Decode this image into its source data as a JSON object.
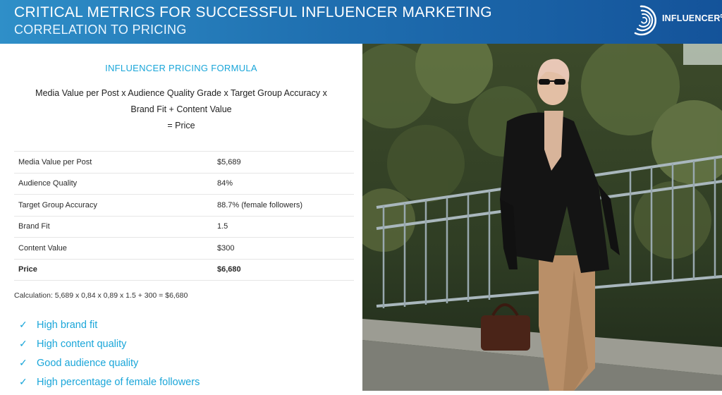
{
  "header": {
    "title": "CRITICAL METRICS FOR SUCCESSFUL INFLUENCER MARKETING",
    "subtitle": "CORRELATION TO PRICING",
    "logo_text": "INFLUENCER",
    "logo_super": "DB",
    "background": "#1f6fb0"
  },
  "formula": {
    "heading": "INFLUENCER PRICING FORMULA",
    "line1": "Media Value per Post x Audience Quality Grade x Target Group Accuracy x",
    "line2": "Brand Fit + Content Value",
    "line3": "= Price"
  },
  "table": {
    "rows": [
      {
        "label": "Media Value per Post",
        "value": "$5,689"
      },
      {
        "label": "Audience Quality",
        "value": "84%"
      },
      {
        "label": "Target Group Accuracy",
        "value": "88.7% (female followers)"
      },
      {
        "label": "Brand Fit",
        "value": "1.5"
      },
      {
        "label": "Content Value",
        "value": "$300"
      },
      {
        "label": "Price",
        "value": "$6,680"
      }
    ]
  },
  "calculation": "Calculation: 5,689 x 0,84 x 0,89 x 1.5 + 300 = $6,680",
  "checklist": {
    "icon": "check-icon",
    "items": [
      "High brand fit",
      "High content quality",
      "Good audience quality",
      "High percentage of female followers"
    ]
  },
  "accent_color": "#1aa6d9"
}
